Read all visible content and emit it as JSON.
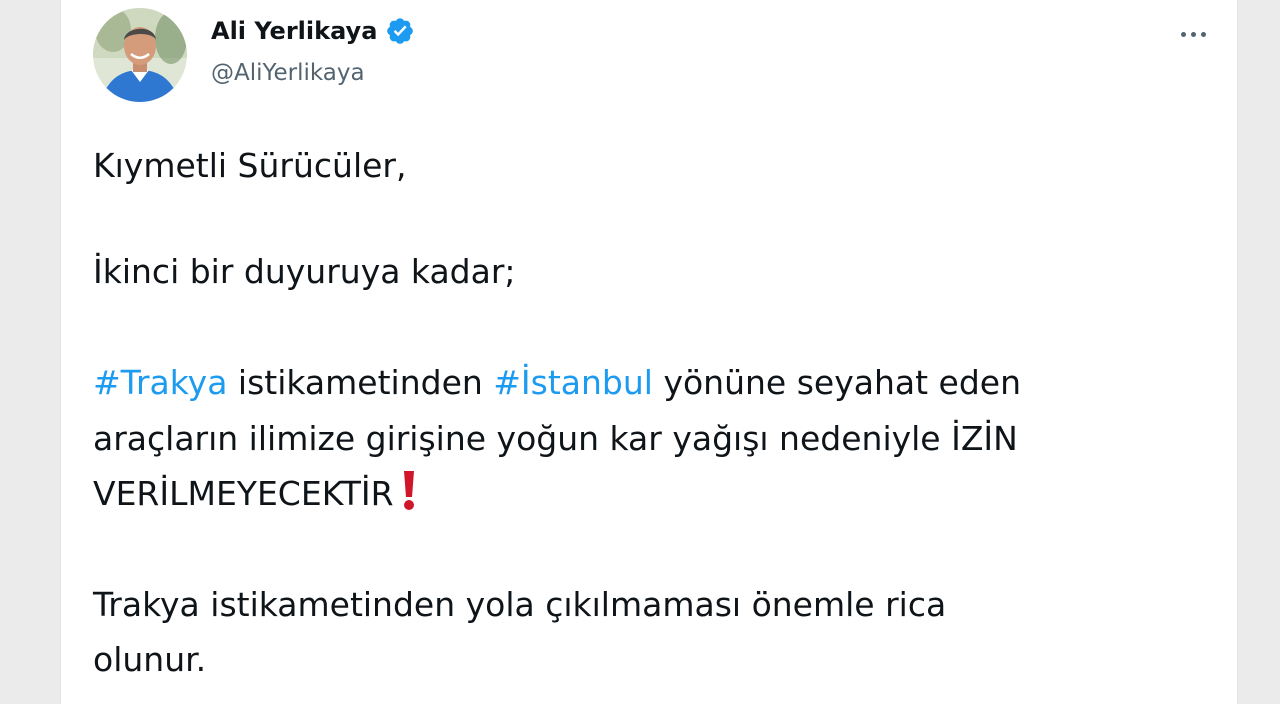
{
  "author": {
    "name": "Ali Yerlikaya",
    "handle": "@AliYerlikaya",
    "verified": true
  },
  "tweet": {
    "greeting": "Kıymetli Sürücüler,",
    "line2": "İkinci bir duyuruya kadar;",
    "hashtag1": "#Trakya",
    "seg1": " istikametinden ",
    "hashtag2": "#İstanbul",
    "seg2": " yönüne seyahat eden",
    "line4": "araçların ilimize girişine yoğun kar yağışı nedeniyle İZİN",
    "line5": "VERİLMEYECEKTİR",
    "line6": "Trakya istikametinden yola çıkılmaması önemle rica",
    "line7": "olunur."
  },
  "icons": {
    "verified": "verified-badge-icon",
    "more": "more-options-icon",
    "emphasis": "red-exclamation-icon"
  },
  "colors": {
    "hashtag": "#1d9bf0",
    "verified": "#1d9bf0",
    "text": "#0f1419",
    "secondary": "#536471",
    "exclamation": "#d0162a"
  }
}
